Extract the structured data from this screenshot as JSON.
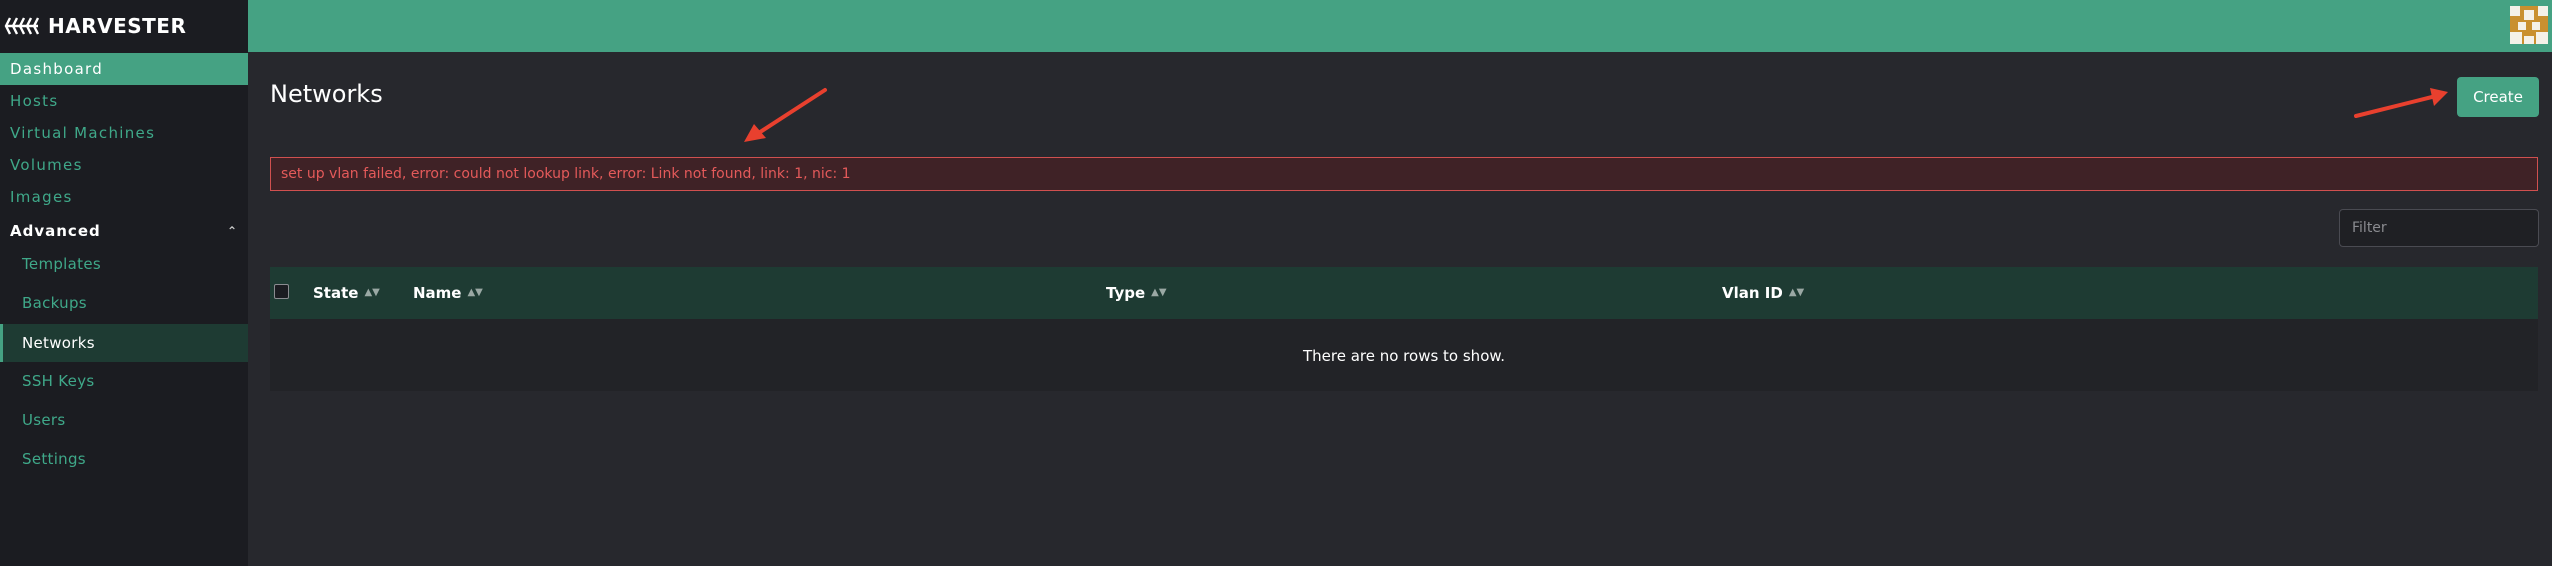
{
  "brand": {
    "name": "HARVESTER"
  },
  "sidebar": {
    "top_items": [
      {
        "label": "Dashboard"
      },
      {
        "label": "Hosts"
      },
      {
        "label": "Virtual Machines"
      },
      {
        "label": "Volumes"
      },
      {
        "label": "Images"
      }
    ],
    "group": {
      "label": "Advanced"
    },
    "sub_items": [
      {
        "label": "Templates"
      },
      {
        "label": "Backups"
      },
      {
        "label": "Networks"
      },
      {
        "label": "SSH Keys"
      },
      {
        "label": "Users"
      },
      {
        "label": "Settings"
      }
    ]
  },
  "page": {
    "title": "Networks",
    "create_label": "Create",
    "error_message": "set up vlan failed, error: could not lookup link, error: Link not found, link: 1, nic: 1",
    "filter_placeholder": "Filter"
  },
  "table": {
    "columns": [
      "State",
      "Name",
      "Type",
      "Vlan ID"
    ],
    "empty_text": "There are no rows to show."
  },
  "colors": {
    "accent": "#45a283",
    "error": "#e45a5a",
    "annotation_arrow": "#e8402e"
  }
}
